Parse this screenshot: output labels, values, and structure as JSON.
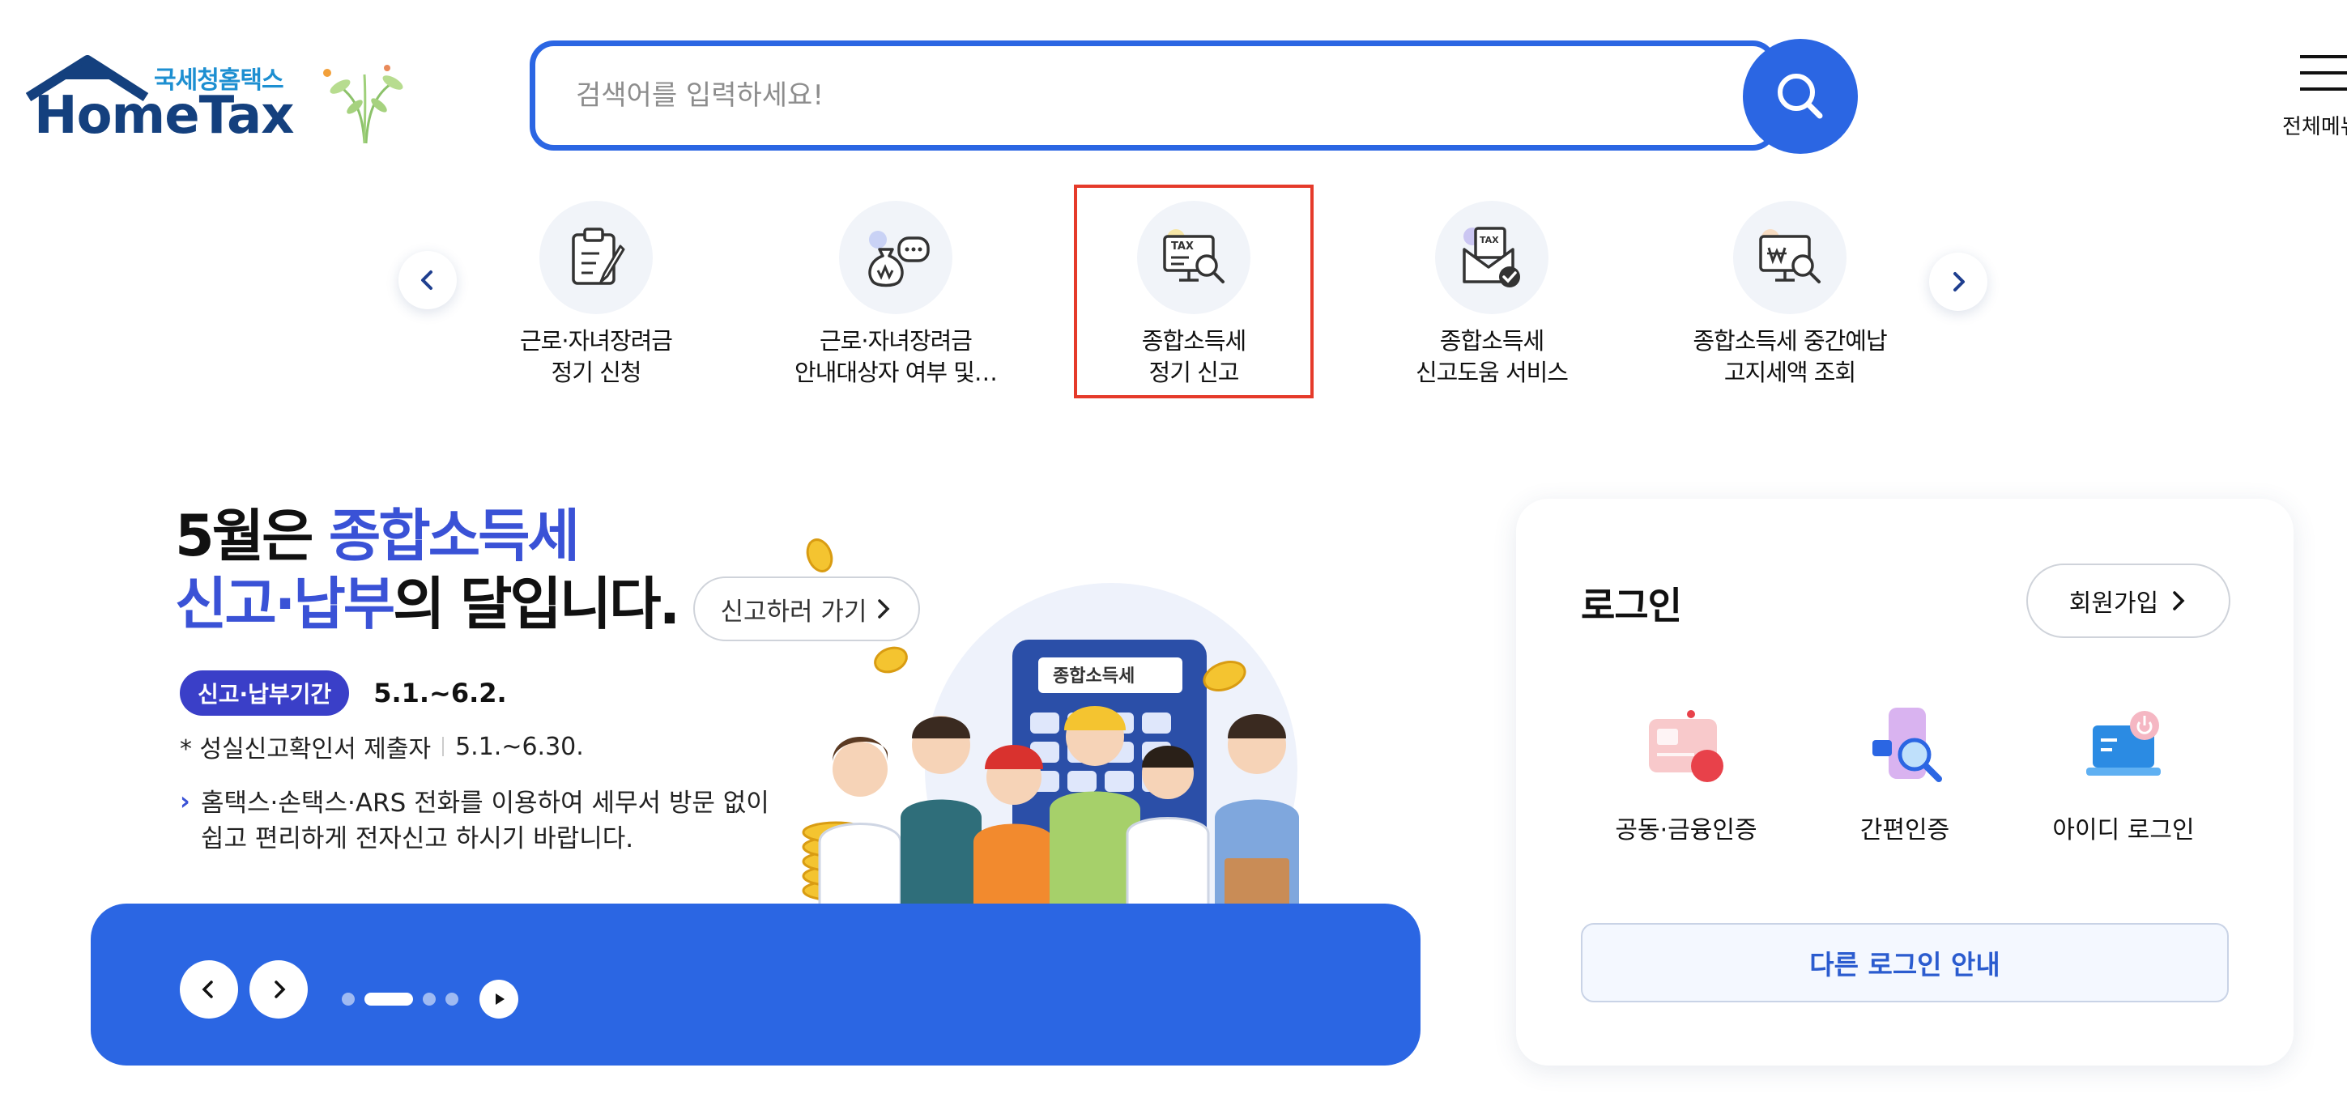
{
  "header": {
    "logo_sub": "국세청홈택스",
    "logo_main": "HomeTax",
    "search_placeholder": "검색어를 입력하세요!",
    "menu_label": "전체메뉴"
  },
  "quick_menu": {
    "items": [
      {
        "line1": "근로·자녀장려금",
        "line2": "정기 신청",
        "icon": "clipboard-pencil-icon"
      },
      {
        "line1": "근로·자녀장려금",
        "line2": "안내대상자 여부 및…",
        "icon": "money-bag-chat-icon"
      },
      {
        "line1": "종합소득세",
        "line2": "정기 신고",
        "icon": "tax-monitor-search-icon"
      },
      {
        "line1": "종합소득세",
        "line2": "신고도움 서비스",
        "icon": "tax-envelope-check-icon"
      },
      {
        "line1": "종합소득세 중간예납",
        "line2": "고지세액 조회",
        "icon": "won-monitor-search-icon"
      }
    ],
    "highlight_index": 2
  },
  "banner": {
    "title_l1_a": "5월은 ",
    "title_l1_b": "종합소득세",
    "title_l2_a": "신고·납부",
    "title_l2_b": "의 달입니다.",
    "cta_label": "신고하러 가기",
    "period_badge": "신고·납부기간",
    "period_text": "5.1.~6.2.",
    "note_label": "* 성실신고확인서 제출자",
    "note_period": "5.1.~6.30.",
    "desc_line1": "홈택스·손택스·ARS 전화를 이용하여 세무서 방문 없이",
    "desc_line2": "쉽고 편리하게 전자신고 하시기 바랍니다.",
    "calculator_label": "종합소득세",
    "slide_count": 4,
    "active_slide": 2,
    "accent_color": "#2b66e3"
  },
  "login": {
    "title": "로그인",
    "join_label": "회원가입",
    "options": [
      {
        "label": "공동·금융인증",
        "icon": "certificate-card-icon"
      },
      {
        "label": "간편인증",
        "icon": "phone-search-icon"
      },
      {
        "label": "아이디 로그인",
        "icon": "laptop-power-icon"
      }
    ],
    "other_login_label": "다른 로그인 안내"
  }
}
